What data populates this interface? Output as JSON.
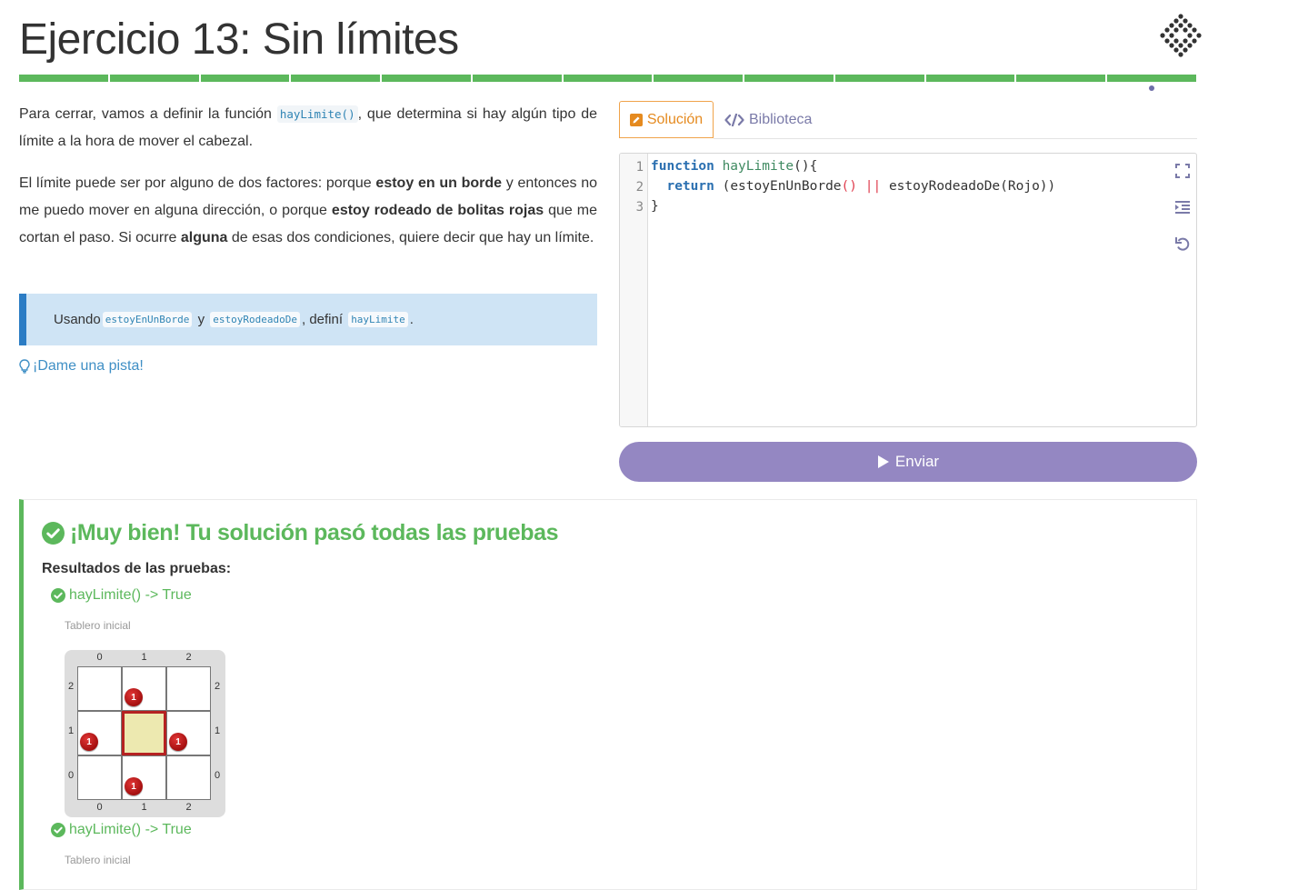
{
  "header": {
    "title": "Ejercicio 13: Sin límites",
    "progress_segments": 13,
    "logo_icon": "gobstones-logo-icon"
  },
  "description": {
    "p1_a": "Para cerrar, vamos a definir la función ",
    "p1_code": "hayLimite()",
    "p1_b": ", que determina si hay algún tipo de límite a la hora de mover el cabezal.",
    "p2_a": "El límite puede ser por alguno de dos factores: porque ",
    "p2_b1": "estoy en un borde",
    "p2_c": " y entonces no me puedo mover en alguna dirección, o porque ",
    "p2_b2": "estoy rodeado de bolitas rojas",
    "p2_d": " que me cortan el paso. Si ocurre ",
    "p2_b3": "alguna",
    "p2_e": " de esas dos condiciones, quiere decir que hay un límite."
  },
  "hint": {
    "t1": "Usando ",
    "c1": "estoyEnUnBorde",
    "t2": " y ",
    "c2": "estoyRodeadoDe",
    "t3": ", definí ",
    "c3": "hayLimite",
    "t4": "."
  },
  "pista_link": "¡Dame una pista!",
  "tabs": {
    "solucion": "Solución",
    "biblioteca": "Biblioteca"
  },
  "editor": {
    "line_numbers": [
      "1",
      "2",
      "3"
    ],
    "line1_kw": "function",
    "line1_fn": "hayLimite",
    "line1_rest": "(){",
    "line2_kw": "return",
    "line2_a": " (estoyEnUnBorde",
    "line2_paren": "()",
    "line2_op": " || ",
    "line2_b": "estoyRodeadoDe(Rojo))",
    "line3": "}"
  },
  "submit_label": "Enviar",
  "result": {
    "title": "¡Muy bien! Tu solución pasó todas las pruebas",
    "subtitle": "Resultados de las pruebas:",
    "tests": [
      {
        "label": "hayLimite() -> True",
        "board_label": "Tablero inicial"
      },
      {
        "label": "hayLimite() -> True",
        "board_label": "Tablero inicial"
      }
    ],
    "board": {
      "col_labels": [
        "0",
        "1",
        "2"
      ],
      "row_labels": [
        "2",
        "1",
        "0"
      ],
      "balls": [
        {
          "col": 1,
          "row": 2,
          "count": "1",
          "color": "#c41a1a"
        },
        {
          "col": 0,
          "row": 1,
          "count": "1",
          "color": "#c41a1a"
        },
        {
          "col": 2,
          "row": 1,
          "count": "1",
          "color": "#c41a1a"
        },
        {
          "col": 1,
          "row": 0,
          "count": "1",
          "color": "#c41a1a"
        }
      ],
      "head": {
        "col": 1,
        "row": 1
      }
    }
  },
  "colors": {
    "accent_green": "#5cb85c",
    "submit_purple": "#9487c2",
    "tab_orange": "#e58a1f",
    "link_blue": "#3f8fc5"
  }
}
